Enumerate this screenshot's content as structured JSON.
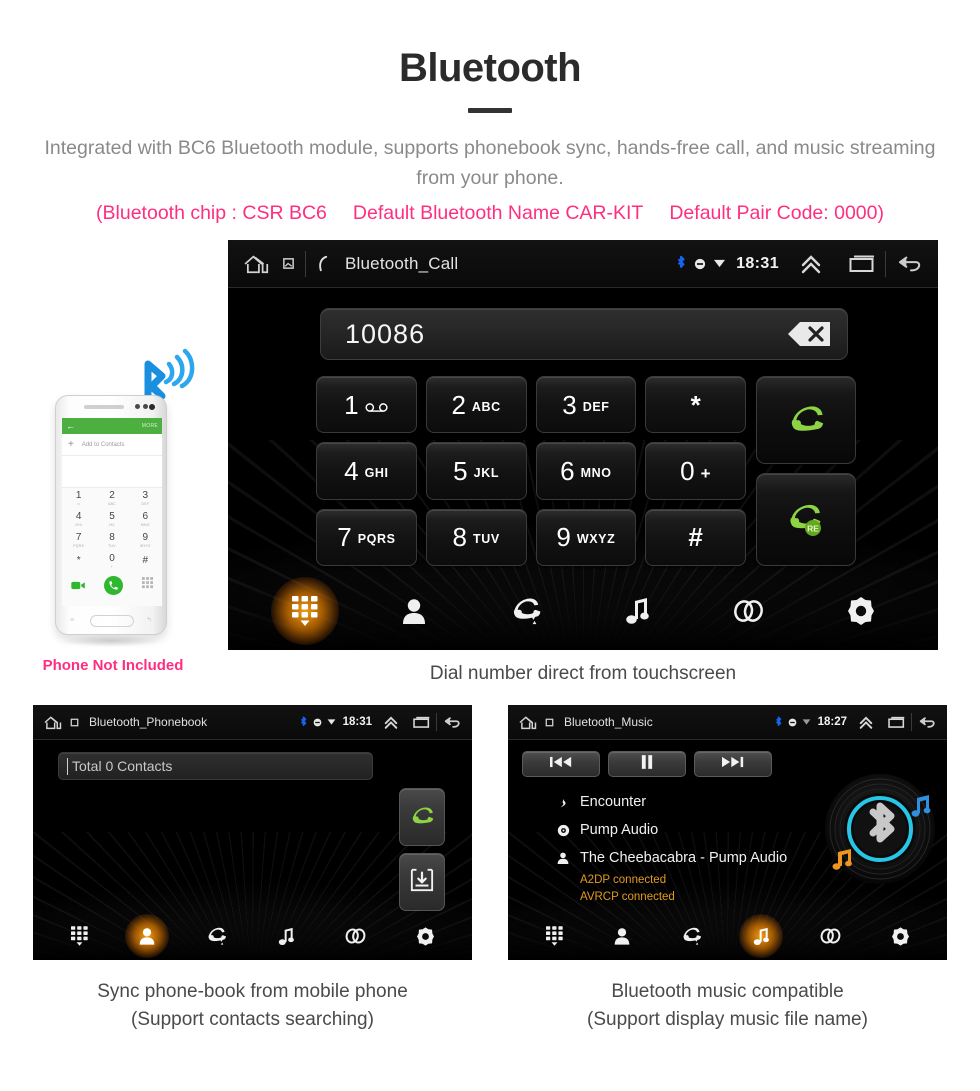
{
  "header": {
    "title": "Bluetooth",
    "subtitle": "Integrated with BC6 Bluetooth module, supports phonebook sync, hands-free call, and music streaming from your phone.",
    "spec_open": "(Bluetooth chip : CSR BC6",
    "spec_name": "Default Bluetooth Name CAR-KIT",
    "spec_pair": "Default Pair Code: 0000)",
    "pink_color": "#ff2e80",
    "subtitle_color": "#8a8a8a"
  },
  "main_screen": {
    "statusbar": {
      "title": "Bluetooth_Call",
      "time": "18:31",
      "home_icon": "home-icon",
      "screen_icon": "screen-icon",
      "phone_icon": "phone-icon",
      "bluetooth_icon": "bluetooth-icon",
      "mute_icon": "mute-icon",
      "signal_icon": "signal-icon",
      "expand_icon": "chevron-up-icon",
      "recents_icon": "recent-apps-icon",
      "back_icon": "back-icon"
    },
    "number_value": "10086",
    "backspace_icon": "backspace-icon",
    "keys": [
      {
        "digit": "1",
        "letters": "",
        "icon": "voicemail-icon"
      },
      {
        "digit": "2",
        "letters": "ABC",
        "icon": ""
      },
      {
        "digit": "3",
        "letters": "DEF",
        "icon": ""
      },
      {
        "digit": "*",
        "letters": "",
        "icon": ""
      },
      {
        "digit": "4",
        "letters": "GHI",
        "icon": ""
      },
      {
        "digit": "5",
        "letters": "JKL",
        "icon": ""
      },
      {
        "digit": "6",
        "letters": "MNO",
        "icon": ""
      },
      {
        "digit": "0",
        "letters": "+",
        "icon": ""
      },
      {
        "digit": "7",
        "letters": "PQRS",
        "icon": ""
      },
      {
        "digit": "8",
        "letters": "TUV",
        "icon": ""
      },
      {
        "digit": "9",
        "letters": "WXYZ",
        "icon": ""
      },
      {
        "digit": "#",
        "letters": "",
        "icon": ""
      }
    ],
    "call_button": "call-icon",
    "redial_button": "redial-icon",
    "redial_badge": "RE",
    "nav": [
      {
        "name": "dialpad",
        "icon": "dialpad-icon",
        "active": true
      },
      {
        "name": "contacts",
        "icon": "contact-icon",
        "active": false
      },
      {
        "name": "call-history",
        "icon": "call-history-icon",
        "active": false
      },
      {
        "name": "music",
        "icon": "music-note-icon",
        "active": false
      },
      {
        "name": "pair",
        "icon": "link-icon",
        "active": false
      },
      {
        "name": "settings",
        "icon": "gear-icon",
        "active": false
      }
    ],
    "caption": "Dial number direct from touchscreen"
  },
  "phone_illustration": {
    "bt_icon": "bluetooth-wave-icon",
    "app_more_label": "MORE",
    "add_contacts_label": "Add to Contacts",
    "keys": [
      {
        "digit": "1",
        "letters": "∞"
      },
      {
        "digit": "2",
        "letters": "ABC"
      },
      {
        "digit": "3",
        "letters": "DEF"
      },
      {
        "digit": "4",
        "letters": "GHI"
      },
      {
        "digit": "5",
        "letters": "JKL"
      },
      {
        "digit": "6",
        "letters": "MNO"
      },
      {
        "digit": "7",
        "letters": "PQRS"
      },
      {
        "digit": "8",
        "letters": "TUV"
      },
      {
        "digit": "9",
        "letters": "WXYZ"
      },
      {
        "digit": "*",
        "letters": ""
      },
      {
        "digit": "0",
        "letters": "+"
      },
      {
        "digit": "#",
        "letters": ""
      }
    ],
    "disclaimer": "Phone Not Included"
  },
  "phonebook_screen": {
    "statusbar": {
      "title": "Bluetooth_Phonebook",
      "time": "18:31"
    },
    "search_text": "Total 0 Contacts",
    "call_button": "call-icon",
    "download_button": "download-contacts-icon",
    "nav": [
      {
        "name": "dialpad",
        "icon": "dialpad-icon",
        "active": false
      },
      {
        "name": "contacts",
        "icon": "contact-icon",
        "active": true
      },
      {
        "name": "call-history",
        "icon": "call-history-icon",
        "active": false
      },
      {
        "name": "music",
        "icon": "music-note-icon",
        "active": false
      },
      {
        "name": "pair",
        "icon": "link-icon",
        "active": false
      },
      {
        "name": "settings",
        "icon": "gear-icon",
        "active": false
      }
    ],
    "caption_line1": "Sync phone-book from mobile phone",
    "caption_line2": "(Support contacts searching)"
  },
  "music_screen": {
    "statusbar": {
      "title": "Bluetooth_Music",
      "time": "18:27"
    },
    "controls": [
      {
        "name": "previous",
        "icon": "skip-back-icon"
      },
      {
        "name": "pause",
        "icon": "pause-icon"
      },
      {
        "name": "next",
        "icon": "skip-forward-icon"
      }
    ],
    "track_title": "Encounter",
    "album": "Pump Audio",
    "artist": "The Cheebacabra - Pump Audio",
    "status_a2dp": "A2DP connected",
    "status_avrcp": "AVRCP connected",
    "status_color": "#e29a1e",
    "vinyl_icon": "bluetooth-vinyl-icon",
    "nav": [
      {
        "name": "dialpad",
        "icon": "dialpad-icon",
        "active": false
      },
      {
        "name": "contacts",
        "icon": "contact-icon",
        "active": false
      },
      {
        "name": "call-history",
        "icon": "call-history-icon",
        "active": false
      },
      {
        "name": "music",
        "icon": "music-note-icon",
        "active": true
      },
      {
        "name": "pair",
        "icon": "link-icon",
        "active": false
      },
      {
        "name": "settings",
        "icon": "gear-icon",
        "active": false
      }
    ],
    "caption_line1": "Bluetooth music compatible",
    "caption_line2": "(Support display music file name)"
  }
}
